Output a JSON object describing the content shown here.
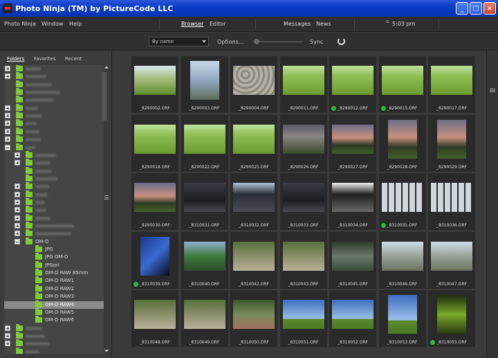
{
  "window": {
    "title": "Photo Ninja (TM) by PictureCode LLC"
  },
  "menubar": {
    "items": [
      "Photo Ninja",
      "Window",
      "Help"
    ],
    "views": [
      "Browser",
      "Editor"
    ],
    "panels": [
      "Messages",
      "News"
    ],
    "clock": "5:03 pm"
  },
  "toolbar": {
    "sort_value": "By name",
    "options_label": "Options...",
    "sync_label": "Sync"
  },
  "left_tabs": [
    "Folders",
    "Favorites",
    "Recent"
  ],
  "tree": {
    "om_d": "OM-D",
    "children": [
      "JPG",
      "JPG OM-D",
      "JPGori",
      "OM-D RAW 85mm",
      "OM-D RAW1",
      "OM-D RAW2",
      "OM-D RAW3",
      "OM-D RAW4",
      "OM-D RAW5",
      "OM-D RAW6"
    ],
    "selected": "OM-D RAW4"
  },
  "thumbnails": [
    [
      "_8290002.ORF",
      "_8290003.ORF",
      "_8290004.ORF",
      "_8290011.ORF",
      "_8290012.ORF",
      "_8290015.ORF",
      "_8290017.ORF"
    ],
    [
      "_8290018.ORF",
      "_8290022.ORF",
      "_8290025.ORF",
      "_8290026.ORF",
      "_8290027.ORF",
      "_8290028.ORF",
      "_8290029.ORF"
    ],
    [
      "_8290030.ORF",
      "_8310031.ORF",
      "_8310032.ORF",
      "_8310033.ORF",
      "_8310034.ORF",
      "_8310035.ORF",
      "_8310036.ORF"
    ],
    [
      "_8310039.ORF",
      "_8310040.ORF",
      "_8310042.ORF",
      "_8310043.ORF",
      "_8310045.ORF",
      "_8310046.ORF",
      "_8310047.ORF"
    ],
    [
      "_8310048.ORF",
      "_8310049.ORF",
      "_8310050.ORF",
      "_8310051.ORF",
      "_8310052.ORF",
      "_8310053.ORF",
      "_8310055.ORF"
    ]
  ],
  "colors": {
    "accent": "#0a3cc7",
    "tag_green": "#2dbf3c",
    "folder_green": "#7ccc3a"
  }
}
